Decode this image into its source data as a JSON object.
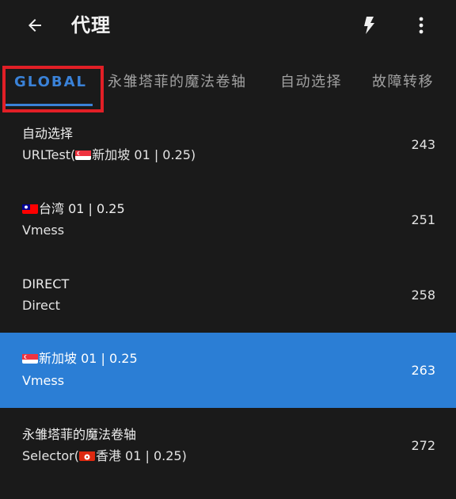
{
  "appbar": {
    "back_icon": "arrow-left-icon",
    "title": "代理",
    "bolt_icon": "lightning-bolt-icon",
    "more_icon": "more-vert-icon"
  },
  "tabs": [
    {
      "label": "GLOBAL",
      "active": true
    },
    {
      "label": "永雏塔菲的魔法卷轴",
      "active": false
    },
    {
      "label": "自动选择",
      "active": false
    },
    {
      "label": "故障转移",
      "active": false
    }
  ],
  "colors": {
    "background": "#1a1a1a",
    "accent": "#3a82d8",
    "selected_row": "#2b7ed5",
    "highlight_border": "#e11f26"
  },
  "proxies": [
    {
      "name": "自动选择",
      "type_prefix": "URLTest(",
      "type_flag": "sg-flag",
      "type_rest": "新加坡 01 | 0.25)",
      "delay": "243",
      "selected": false
    },
    {
      "name_flag": "tw-flag",
      "name": "台湾 01 | 0.25",
      "type": "Vmess",
      "delay": "251",
      "selected": false
    },
    {
      "name": "DIRECT",
      "type": "Direct",
      "delay": "258",
      "selected": false
    },
    {
      "name_flag": "sg-flag",
      "name": "新加坡 01 | 0.25",
      "type": "Vmess",
      "delay": "263",
      "selected": true
    },
    {
      "name": "永雏塔菲的魔法卷轴",
      "type_prefix": "Selector(",
      "type_flag": "hk-flag",
      "type_rest": "香港 01 | 0.25)",
      "delay": "272",
      "selected": false
    }
  ]
}
